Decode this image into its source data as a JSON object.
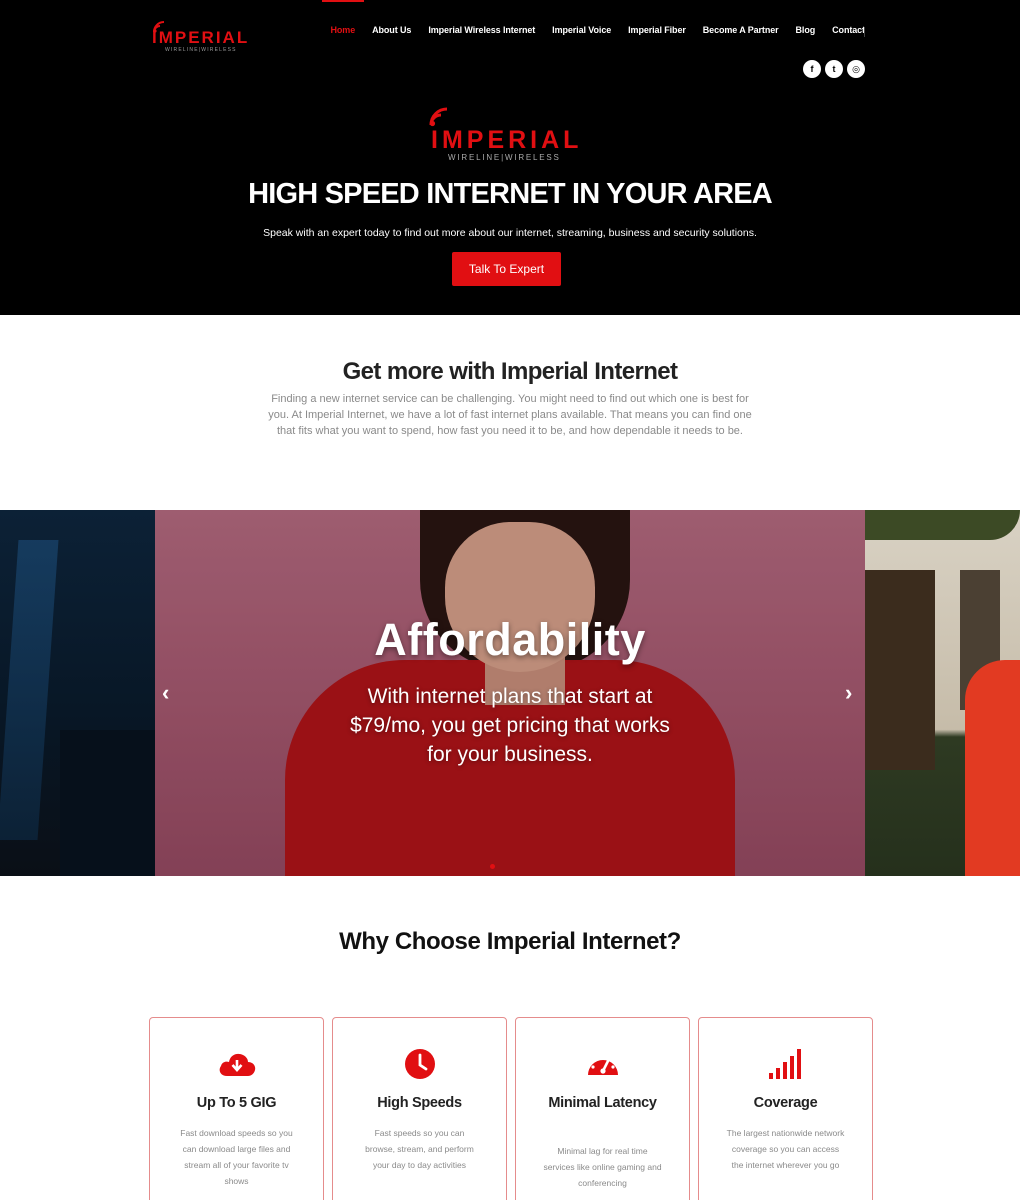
{
  "brand": {
    "name": "IMPERIAL",
    "tagline": "WIRELINE|WIRELESS",
    "accent_color": "#e10f12"
  },
  "nav": {
    "items": [
      {
        "label": "Home",
        "active": true
      },
      {
        "label": "About Us"
      },
      {
        "label": "Imperial Wireless Internet"
      },
      {
        "label": "Imperial Voice"
      },
      {
        "label": "Imperial Fiber"
      },
      {
        "label": "Become A Partner"
      },
      {
        "label": "Blog"
      },
      {
        "label": "Contact"
      }
    ]
  },
  "socials": [
    {
      "icon": "facebook-icon",
      "glyph": "f"
    },
    {
      "icon": "twitter-icon",
      "glyph": "t"
    },
    {
      "icon": "instagram-icon",
      "glyph": "◎"
    }
  ],
  "hero": {
    "title": "HIGH SPEED INTERNET IN YOUR AREA",
    "subtitle": "Speak with an expert today to find out more about our internet, streaming, business and security solutions.",
    "cta_label": "Talk To Expert"
  },
  "intro": {
    "title": "Get more with Imperial Internet",
    "text": "Finding a new internet service can be challenging. You might need to find out which one is best for you. At Imperial Internet, we have a lot of fast internet plans available. That means you can find one that fits what you want to spend, how fast you need it to be, and how dependable it needs to be."
  },
  "slider": {
    "heading": "Affordability",
    "body": "With internet plans that start at $79/mo, you get pricing that works for your business.",
    "prev_glyph": "‹",
    "next_glyph": "›"
  },
  "why": {
    "title": "Why Choose Imperial Internet?",
    "cards": [
      {
        "icon": "cloud-download-icon",
        "title": "Up To 5 GIG",
        "desc": "Fast download speeds so you can download large files and stream all of your favorite tv shows"
      },
      {
        "icon": "clock-icon",
        "title": "High Speeds",
        "desc": "Fast speeds so you can browse, stream, and perform your day to day activities"
      },
      {
        "icon": "speedometer-icon",
        "title": "Minimal Latency",
        "desc": "Minimal lag for real time services like online gaming and conferencing"
      },
      {
        "icon": "signal-bars-icon",
        "title": "Coverage",
        "desc": "The largest nationwide network coverage so you can access the internet wherever you go"
      }
    ]
  }
}
